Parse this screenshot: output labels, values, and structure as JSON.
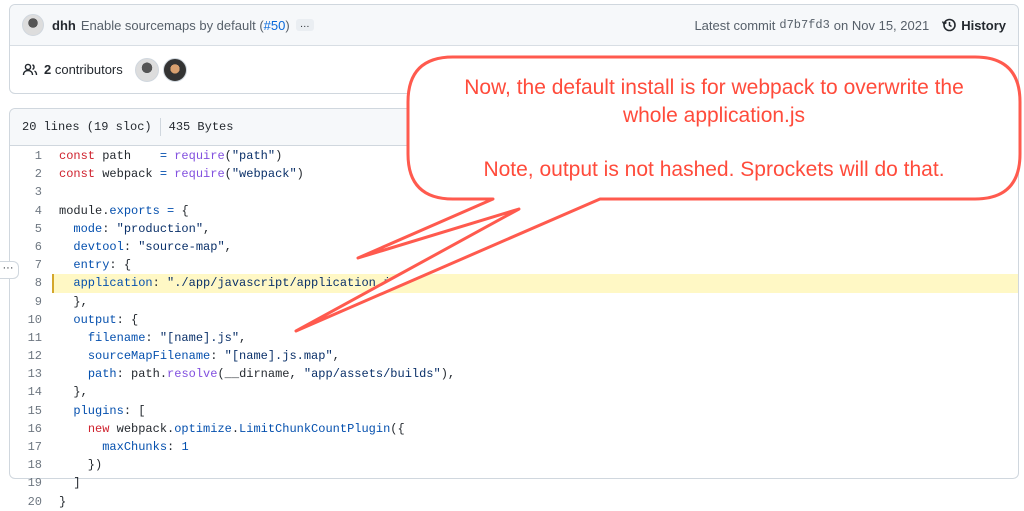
{
  "commit": {
    "author": "dhh",
    "message": "Enable sourcemaps by default (",
    "pr": "#50",
    "close_paren": ")",
    "more": "…",
    "latest_label": "Latest commit",
    "sha": "d7b7fd3",
    "date": "on Nov 15, 2021",
    "history": "History"
  },
  "contributors": {
    "label": "2 contributors",
    "count": "2",
    "text": " contributors"
  },
  "file": {
    "lines": "20 lines (19 sloc)",
    "size": "435 Bytes",
    "highlight_line": 8
  },
  "code": [
    [
      [
        "k",
        "const"
      ],
      [
        "t",
        " path    "
      ],
      [
        "p",
        "="
      ],
      [
        "t",
        " "
      ],
      [
        "f",
        "require"
      ],
      [
        "t",
        "("
      ],
      [
        "s",
        "\"path\""
      ],
      [
        "t",
        ")"
      ]
    ],
    [
      [
        "k",
        "const"
      ],
      [
        "t",
        " webpack "
      ],
      [
        "p",
        "="
      ],
      [
        "t",
        " "
      ],
      [
        "f",
        "require"
      ],
      [
        "t",
        "("
      ],
      [
        "s",
        "\"webpack\""
      ],
      [
        "t",
        ")"
      ]
    ],
    [],
    [
      [
        "t",
        "module."
      ],
      [
        "p",
        "exports"
      ],
      [
        "t",
        " "
      ],
      [
        "p",
        "="
      ],
      [
        "t",
        " {"
      ]
    ],
    [
      [
        "t",
        "  "
      ],
      [
        "p",
        "mode"
      ],
      [
        "t",
        ": "
      ],
      [
        "s",
        "\"production\""
      ],
      [
        "t",
        ","
      ]
    ],
    [
      [
        "t",
        "  "
      ],
      [
        "p",
        "devtool"
      ],
      [
        "t",
        ": "
      ],
      [
        "s",
        "\"source-map\""
      ],
      [
        "t",
        ","
      ]
    ],
    [
      [
        "t",
        "  "
      ],
      [
        "p",
        "entry"
      ],
      [
        "t",
        ": {"
      ]
    ],
    [
      [
        "t",
        "  "
      ],
      [
        "p",
        "application"
      ],
      [
        "t",
        ": "
      ],
      [
        "s",
        "\"./app/javascript/application.js\""
      ]
    ],
    [
      [
        "t",
        "  },"
      ]
    ],
    [
      [
        "t",
        "  "
      ],
      [
        "p",
        "output"
      ],
      [
        "t",
        ": {"
      ]
    ],
    [
      [
        "t",
        "    "
      ],
      [
        "p",
        "filename"
      ],
      [
        "t",
        ": "
      ],
      [
        "s",
        "\"[name].js\""
      ],
      [
        "t",
        ","
      ]
    ],
    [
      [
        "t",
        "    "
      ],
      [
        "p",
        "sourceMapFilename"
      ],
      [
        "t",
        ": "
      ],
      [
        "s",
        "\"[name].js.map\""
      ],
      [
        "t",
        ","
      ]
    ],
    [
      [
        "t",
        "    "
      ],
      [
        "p",
        "path"
      ],
      [
        "t",
        ": path."
      ],
      [
        "f",
        "resolve"
      ],
      [
        "t",
        "(__dirname, "
      ],
      [
        "s",
        "\"app/assets/builds\""
      ],
      [
        "t",
        "),"
      ]
    ],
    [
      [
        "t",
        "  },"
      ]
    ],
    [
      [
        "t",
        "  "
      ],
      [
        "p",
        "plugins"
      ],
      [
        "t",
        ": ["
      ]
    ],
    [
      [
        "t",
        "    "
      ],
      [
        "k",
        "new"
      ],
      [
        "t",
        " webpack."
      ],
      [
        "p",
        "optimize"
      ],
      [
        "t",
        "."
      ],
      [
        "p",
        "LimitChunkCountPlugin"
      ],
      [
        "t",
        "({"
      ]
    ],
    [
      [
        "t",
        "      "
      ],
      [
        "p",
        "maxChunks"
      ],
      [
        "t",
        ": "
      ],
      [
        "p",
        "1"
      ]
    ],
    [
      [
        "t",
        "    })"
      ]
    ],
    [
      [
        "t",
        "  ]"
      ]
    ],
    [
      [
        "t",
        "}"
      ]
    ]
  ],
  "callout": {
    "line1": "Now, the default install is for webpack to overwrite the",
    "line2": "whole application.js",
    "line3": "Note, output is not hashed. Sprockets will do that.",
    "color": "#ff4b3b"
  }
}
